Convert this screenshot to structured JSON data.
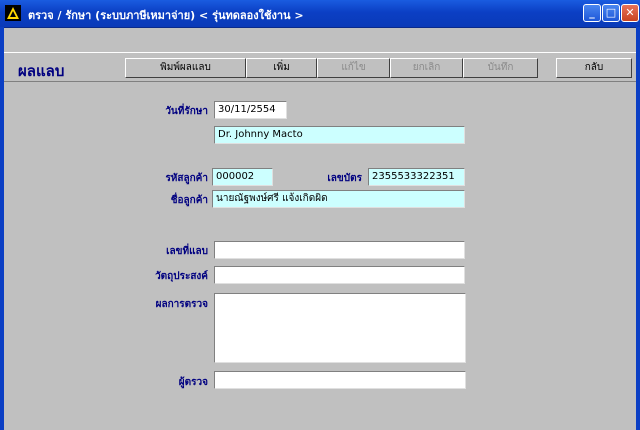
{
  "window": {
    "title": "ตรวจ / รักษา (ระบบภาษีเหมาจ่าย) < รุ่นทดลองใช้งาน >",
    "minimize_glyph": "_",
    "maximize_glyph": "□",
    "close_glyph": "✕"
  },
  "panel": {
    "title": "ผลแลบ"
  },
  "toolbar": {
    "print_label": "พิมพ์ผลแลบ",
    "add_label": "เพิ่ม",
    "edit_label": "แก้ไข",
    "cancel_label": "ยกเลิก",
    "save_label": "บันทึก",
    "back_label": "กลับ"
  },
  "form": {
    "date_label": "วันที่รักษา",
    "date_value": "30/11/2554",
    "doctor_value": "Dr. Johnny Macto",
    "customer_code_label": "รหัสลูกค้า",
    "customer_code_value": "000002",
    "card_label": "เลขบัตร",
    "card_value": "2355533322351",
    "customer_name_label": "ชื่อลูกค้า",
    "customer_name_value": "นายณัฐพงษ์ศรี แจ้งเกิดผิด",
    "lab_no_label": "เลขที่แลบ",
    "lab_no_value": "",
    "purpose_label": "วัตถุประสงค์",
    "purpose_value": "",
    "result_label": "ผลการตรวจ",
    "result_value": "",
    "examiner_label": "ผู้ตรวจ",
    "examiner_value": ""
  }
}
